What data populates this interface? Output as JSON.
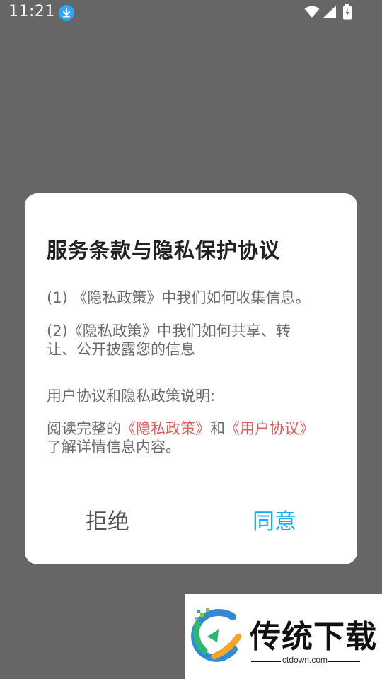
{
  "status_bar": {
    "time": "11:21",
    "icons": [
      "download-icon",
      "wifi-icon",
      "signal-icon",
      "battery-icon"
    ]
  },
  "dialog": {
    "title": "服务条款与隐私保护协议",
    "item1": "(1) 《隐私政策》中我们如何收集信息。",
    "item2": "(2)《隐私政策》中我们如何共享、转让、公开披露您的信息",
    "section_label": "用户协议和隐私政策说明:",
    "read_prefix": "阅读完整的",
    "privacy_link": "《隐私政策》",
    "and_text": "和",
    "user_agreement_link": "《用户协议》",
    "read_suffix": "了解详情信息内容。",
    "reject_label": "拒绝",
    "agree_label": "同意"
  },
  "watermark": {
    "title": "传统下载",
    "domain": "ctdown.com"
  },
  "colors": {
    "overlay": "#666666",
    "link": "#e15b5b",
    "accent": "#1ea7ea"
  }
}
